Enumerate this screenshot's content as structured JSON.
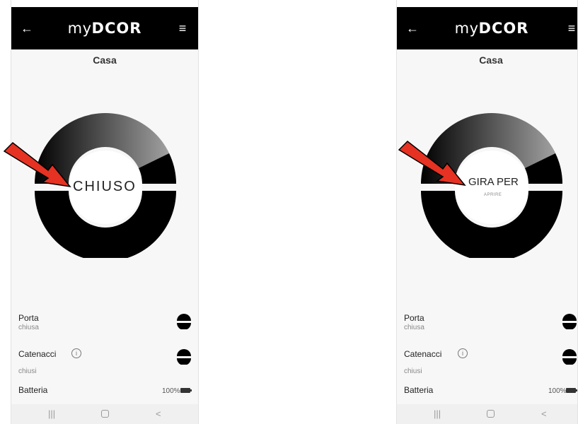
{
  "screens": [
    {
      "logo_my": "my",
      "logo_door": "DCOR",
      "title": "Casa",
      "state_text": "CHIUSO",
      "porta_label": "Porta",
      "porta_status": "chiusa",
      "catenacci_label": "Catenacci",
      "catenacci_status": "chiusi",
      "info_symbol": "i",
      "batteria_label": "Batteria",
      "battery_value": "100%",
      "nav_recent": "|||",
      "nav_back": "<"
    },
    {
      "logo_my": "my",
      "logo_door": "DCOR",
      "title": "Casa",
      "state_text": "GIRA PER",
      "state_subtext": "APRIRE",
      "porta_label": "Porta",
      "porta_status": "chiusa",
      "catenacci_label": "Catenacci",
      "catenacci_status": "chiusi",
      "info_symbol": "i",
      "batteria_label": "Batteria",
      "battery_value": "100%",
      "nav_recent": "|||",
      "nav_back": "<"
    }
  ],
  "icons": {
    "back": "back-arrow-icon",
    "menu": "hamburger-menu-icon",
    "status": "half-circle-lock-icon",
    "info": "info-icon",
    "battery": "battery-icon",
    "annotation": "red-arrow-icon"
  },
  "colors": {
    "app_bar": "#000000",
    "background": "#f7f7f7",
    "annotation_red": "#e63222"
  }
}
